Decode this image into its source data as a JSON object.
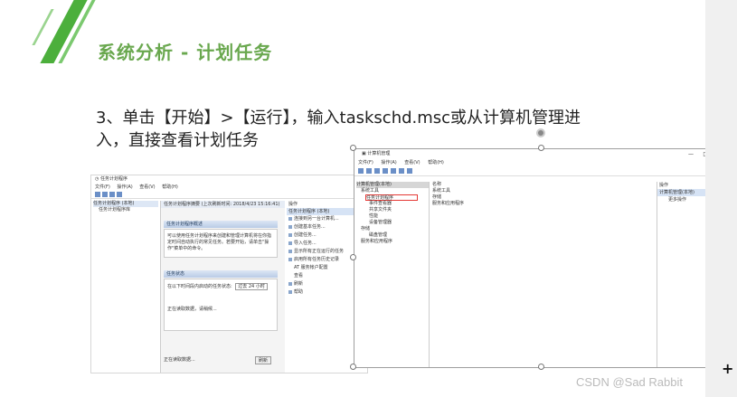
{
  "slide": {
    "title": "系统分析 - 计划任务",
    "body_line1": "3、单击【开始】>【运行】，输入taskschd.msc或从计算机管理进",
    "body_line2": "入，直接查看计划任务"
  },
  "task_scheduler": {
    "window_title": "任务计划程序",
    "menu": [
      "文件(F)",
      "操作(A)",
      "查看(V)",
      "帮助(H)"
    ],
    "tree": [
      "任务计划程序 (本地)",
      "任务计划程序库"
    ],
    "header": "任务计划程序摘要 (上次刷新时间: 2018/4/23 15:16:41)",
    "overview_label": "任务计划程序概述",
    "overview_text": "可以使用任务计划程序来创建和管理计算机将在你指定时间自动执行的常见任务。若要开始，请单击\"操作\"菜单中的命令。",
    "status_label": "任务状态",
    "status_row": "在以下时间段内启动的任务状态:",
    "status_select": "过去 24 小时",
    "loading": "正在读取数据，请稍候...",
    "footer_status": "正在读取数据...",
    "refresh_button": "刷新",
    "actions_header": "操作",
    "actions_selected": "任务计划程序 (本地)",
    "actions": [
      "连接到另一台计算机...",
      "创建基本任务...",
      "创建任务...",
      "导入任务...",
      "显示所有正在运行的任务",
      "启用所有任务历史记录",
      "AT 服务帐户配置",
      "查看",
      "刷新",
      "帮助"
    ]
  },
  "computer_management": {
    "window_title": "计算机管理",
    "menu": [
      "文件(F)",
      "操作(A)",
      "查看(V)",
      "帮助(H)"
    ],
    "tree": [
      {
        "label": "计算机管理(本地)",
        "selected": true
      },
      {
        "label": "系统工具"
      },
      {
        "label": "任务计划程序",
        "highlight": true
      },
      {
        "label": "事件查看器"
      },
      {
        "label": "共享文件夹"
      },
      {
        "label": "性能"
      },
      {
        "label": "设备管理器"
      },
      {
        "label": "存储"
      },
      {
        "label": "磁盘管理"
      },
      {
        "label": "服务和应用程序"
      }
    ],
    "list_header": "名称",
    "list": [
      "系统工具",
      "存储",
      "服务和应用程序"
    ],
    "actions_header": "操作",
    "actions_selected": "计算机管理(本地)",
    "actions_more": "更多操作"
  },
  "watermark": "CSDN @Sad Rabbit",
  "colors": {
    "title_green": "#6aa84f",
    "stripe_green": "#4caf3c",
    "highlight_red": "#e53935"
  }
}
